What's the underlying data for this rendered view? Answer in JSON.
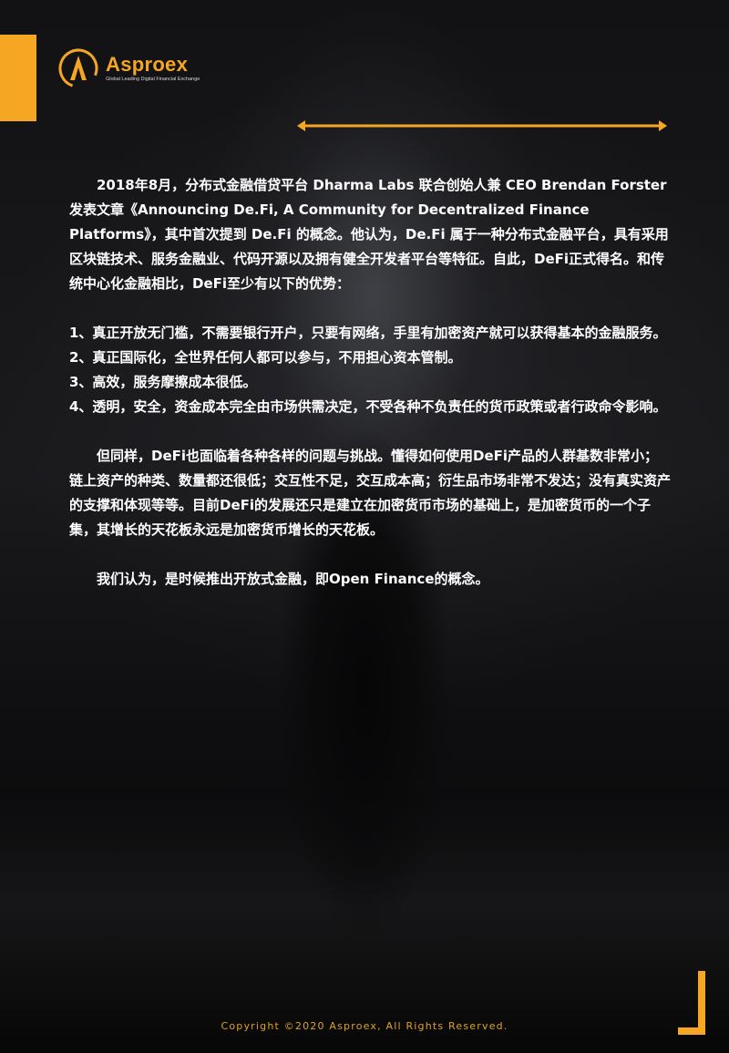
{
  "brand": {
    "name": "Asproex",
    "tagline": "Global Leading Digital Financial Exchange",
    "accent": "#f5a623"
  },
  "article": {
    "intro": "2018年8月，分布式金融借贷平台 Dharma Labs 联合创始人兼 CEO Brendan Forster 发表文章《Announcing De.Fi, A Community for Decentralized Finance Platforms》，其中首次提到 De.Fi 的概念。他认为，De.Fi 属于一种分布式金融平台，具有采用区块链技术、服务金融业、代码开源以及拥有健全开发者平台等特征。自此，DeFi正式得名。和传统中心化金融相比，DeFi至少有以下的优势：",
    "advantages": [
      "1、真正开放无门槛，不需要银行开户，只要有网络，手里有加密资产就可以获得基本的金融服务。",
      "2、真正国际化，全世界任何人都可以参与，不用担心资本管制。",
      "3、高效，服务摩擦成本很低。",
      "4、透明，安全，资金成本完全由市场供需决定，不受各种不负责任的货币政策或者行政命令影响。"
    ],
    "challenges": "但同样，DeFi也面临着各种各样的问题与挑战。懂得如何使用DeFi产品的人群基数非常小；链上资产的种类、数量都还很低；交互性不足，交互成本高；衍生品市场非常不发达；没有真实资产的支撑和体现等等。目前DeFi的发展还只是建立在加密货币市场的基础上，是加密货币的一个子集，其增长的天花板永远是加密货币增长的天花板。",
    "conclusion": "我们认为，是时候推出开放式金融，即Open Finance的概念。"
  },
  "footer": {
    "copyright": "Copyright ©2020 Asproex, All Rights Reserved."
  },
  "icons": {
    "logo": "asproex-logo-icon",
    "divider": "double-arrow-line-icon",
    "corner": "corner-bracket-icon"
  }
}
